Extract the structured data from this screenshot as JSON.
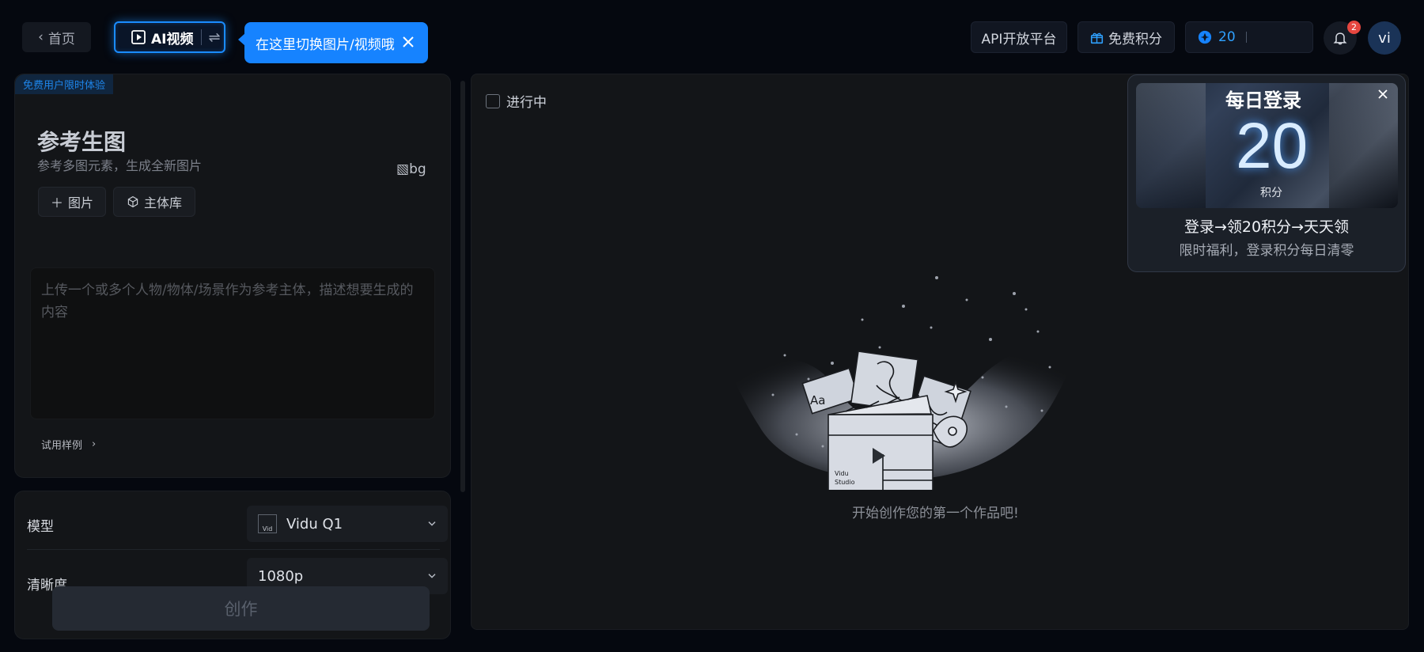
{
  "topbar": {
    "home_label": "首页",
    "mode_label": "AI视频",
    "tooltip_text": "在这里切换图片/视频哦",
    "api_label": "API开放平台",
    "free_points_label": "免费积分",
    "points_value": "20",
    "notification_count": "2",
    "avatar_text": "vi"
  },
  "left_card": {
    "free_tag": "免费用户限时体验",
    "title": "参考生图",
    "subtitle": "参考多图元素，生成全新图片",
    "broken_image_alt": "bg",
    "image_button": "图片",
    "subject_button": "主体库",
    "prompt_placeholder": "上传一个或多个人物/物体/场景作为参考主体，描述想要生成的内容",
    "sample_label": "试用样例"
  },
  "settings": {
    "model_label": "模型",
    "model_value": "Vidu Q1",
    "model_logo_alt": "Vid",
    "resolution_label": "清晰度",
    "resolution_value": "1080p",
    "create_label": "创作"
  },
  "main": {
    "in_progress_label": "进行中",
    "empty_text": "开始创作您的第一个作品吧!",
    "art_text": "Aa",
    "art_brand_1": "Vidu",
    "art_brand_2": "Studio"
  },
  "daily_login": {
    "title": "每日登录",
    "points": "20",
    "unit": "积分",
    "line1": "登录→领20积分→天天领",
    "line2": "限时福利，登录积分每日清零"
  },
  "colors": {
    "accent": "#1683ff",
    "background": "#05080f",
    "panel": "#131518"
  }
}
